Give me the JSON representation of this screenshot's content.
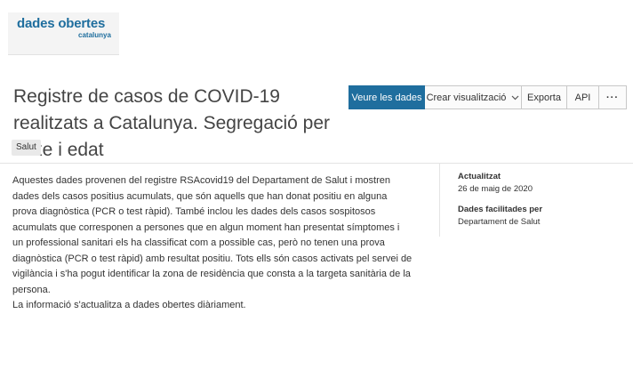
{
  "logo": {
    "main": "dades obertes",
    "sub": "catalunya"
  },
  "dataset": {
    "title": "Registre de casos de COVID-19 realitzats a Catalunya. Segregació per sexe i edat",
    "tag": "Salut"
  },
  "toolbar": {
    "view_data": "Veure les dades",
    "create_visualization": "Crear visualització",
    "export": "Exporta",
    "api": "API",
    "more": "···"
  },
  "description": {
    "paragraph1": "Aquestes dades provenen del registre RSAcovid19 del Departament de Salut i mostren dades dels casos positius acumulats, que són aquells que han donat positiu en alguna prova diagnòstica (PCR o test ràpid). També inclou les dades dels casos sospitosos acumulats que corresponen a persones que en algun moment han presentat símptomes i un professional sanitari els ha classificat com a possible cas, però no tenen una prova diagnòstica (PCR o test ràpid) amb resultat positiu. Tots ells són casos activats pel servei de vigilància i s'ha pogut identificar la zona de residència que consta a la targeta sanitària de la persona.",
    "paragraph2": "La informació s'actualitza a dades obertes diàriament."
  },
  "metadata": {
    "updated_label": "Actualitzat",
    "updated_value": "26 de maig de 2020",
    "provided_by_label": "Dades facilitades per",
    "provided_by_value": "Departament de Salut"
  },
  "icons": {
    "dropdown": "chevron-down-icon",
    "more": "more-options-icon"
  },
  "colors": {
    "brand": "#1f6e9e"
  }
}
